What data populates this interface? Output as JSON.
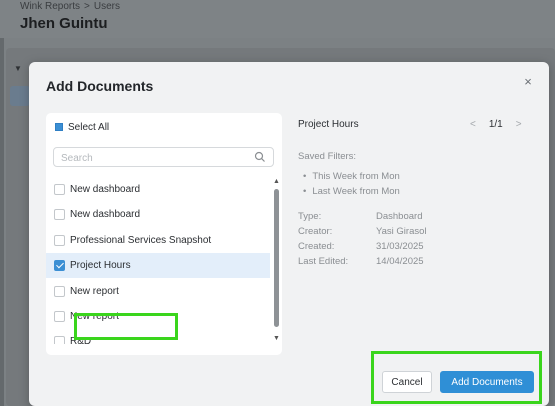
{
  "background": {
    "breadcrumb": [
      "Wink Reports",
      "Users"
    ],
    "breadcrumb_separator": ">",
    "page_title": "Jhen Guintu"
  },
  "modal": {
    "title": "Add Documents",
    "close_icon": "×"
  },
  "list": {
    "select_all_label": "Select All",
    "search_placeholder": "Search",
    "items": [
      {
        "label": "New dashboard",
        "checked": false
      },
      {
        "label": "New dashboard",
        "checked": false
      },
      {
        "label": "Professional Services Snapshot",
        "checked": false
      },
      {
        "label": "Project Hours",
        "checked": true
      },
      {
        "label": "New report",
        "checked": false
      },
      {
        "label": "New report",
        "checked": false
      },
      {
        "label": "R&D",
        "checked": false
      }
    ]
  },
  "detail": {
    "title": "Project Hours",
    "pager": "1/1",
    "saved_filters_label": "Saved Filters:",
    "filters": [
      "This Week from Mon",
      "Last Week from Mon"
    ],
    "meta": [
      {
        "key": "Type:",
        "value": "Dashboard"
      },
      {
        "key": "Creator:",
        "value": "Yasi Girasol"
      },
      {
        "key": "Created:",
        "value": "31/03/2025"
      },
      {
        "key": "Last Edited:",
        "value": "14/04/2025"
      }
    ]
  },
  "footer": {
    "cancel_label": "Cancel",
    "add_label": "Add Documents"
  },
  "colors": {
    "accent": "#2f8fd6",
    "highlight": "#3ad51c",
    "selected_row": "#e3eefa"
  }
}
